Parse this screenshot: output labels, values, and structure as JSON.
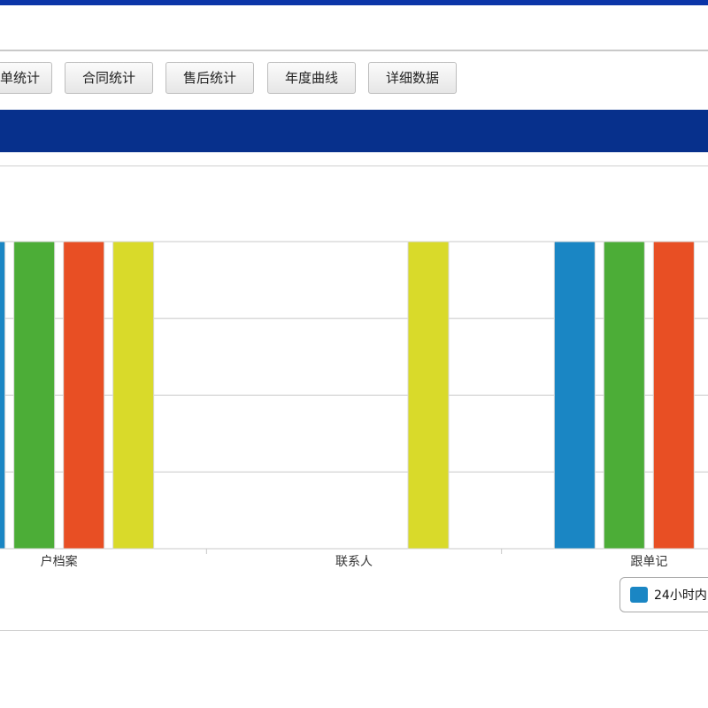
{
  "toolbar": {
    "buttons": [
      "单统计",
      "合同统计",
      "售后统计",
      "年度曲线",
      "详细数据"
    ]
  },
  "colors": {
    "top_bar": "#0b35a8",
    "band": "#07308c",
    "blue": "#1a86c4",
    "green": "#4cad37",
    "red": "#e84f24",
    "yellow": "#d9da2a"
  },
  "chart_data": {
    "type": "bar",
    "categories": [
      "客户档案",
      "联系人",
      "跟单记录"
    ],
    "category_labels_visible": [
      "户档案",
      "联系人",
      "跟单记"
    ],
    "series": [
      {
        "name": "24小时内",
        "color": "#1a86c4",
        "values": [
          4,
          0,
          4
        ]
      },
      {
        "color": "#4cad37",
        "values": [
          4,
          0,
          4
        ]
      },
      {
        "color": "#e84f24",
        "values": [
          4,
          0,
          4
        ]
      },
      {
        "color": "#d9da2a",
        "values": [
          4,
          4,
          0
        ]
      }
    ],
    "ylim": [
      0,
      4
    ],
    "grid": true,
    "legend": "bottom-right",
    "legend_visible_text": "24小时内"
  }
}
